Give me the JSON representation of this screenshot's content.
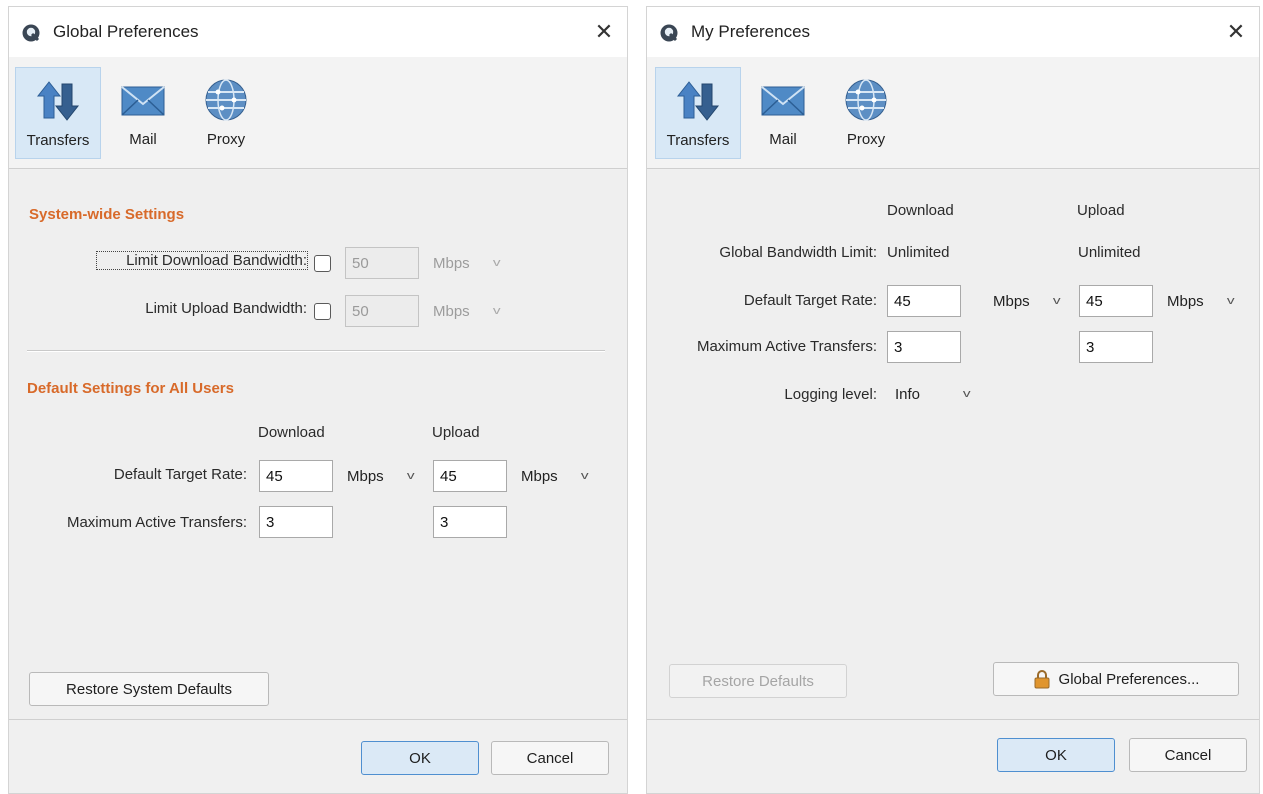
{
  "global": {
    "title": "Global Preferences",
    "close": "✕",
    "tools": [
      "Transfers",
      "Mail",
      "Proxy"
    ],
    "system_title": "System-wide Settings",
    "limit_download_label": "Limit Download Bandwidth:",
    "limit_upload_label": "Limit Upload Bandwidth:",
    "limit_download_value": "50",
    "limit_upload_value": "50",
    "unit": "Mbps",
    "defaults_title": "Default Settings for All Users",
    "col_download": "Download",
    "col_upload": "Upload",
    "target_rate_label": "Default Target Rate:",
    "target_download": "45",
    "target_upload": "45",
    "max_active_label": "Maximum Active Transfers:",
    "max_download": "3",
    "max_upload": "3",
    "restore_button": "Restore System Defaults",
    "ok_button": "OK",
    "cancel_button": "Cancel"
  },
  "my": {
    "title": "My Preferences",
    "close": "✕",
    "tools": [
      "Transfers",
      "Mail",
      "Proxy"
    ],
    "col_download": "Download",
    "col_upload": "Upload",
    "bandwidth_label": "Global Bandwidth Limit:",
    "bandwidth_download": "Unlimited",
    "bandwidth_upload": "Unlimited",
    "target_rate_label": "Default Target Rate:",
    "target_download": "45",
    "target_upload": "45",
    "unit": "Mbps",
    "max_active_label": "Maximum Active Transfers:",
    "max_download": "3",
    "max_upload": "3",
    "logging_label": "Logging level:",
    "logging_value": "Info",
    "restore_button": "Restore Defaults",
    "global_prefs_button": "Global Preferences...",
    "ok_button": "OK",
    "cancel_button": "Cancel"
  },
  "icons": {
    "app": "app-logo-icon",
    "transfers": "transfers-arrows-icon",
    "mail": "mail-envelope-icon",
    "proxy": "proxy-globe-icon",
    "lock": "lock-icon",
    "caret": "chevron-down-icon"
  },
  "colors": {
    "section_title": "#d86a2a",
    "selected_tool": "#d8e8f6",
    "default_button_border": "#4f8fd0"
  }
}
